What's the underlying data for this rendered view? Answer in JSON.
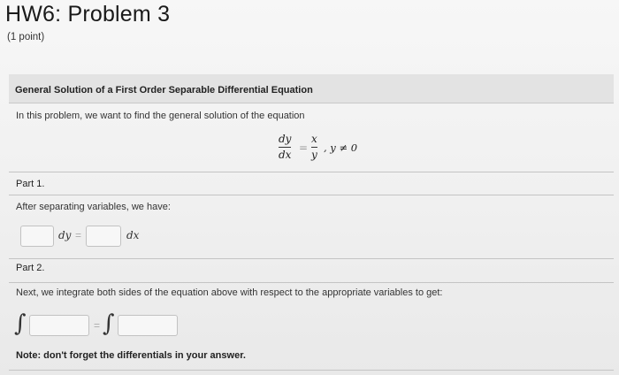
{
  "header": {
    "title": "HW6: Problem 3",
    "points": "(1 point)"
  },
  "section": {
    "title": "General Solution of a First Order Separable Differential Equation",
    "intro": "In this problem, we want to find the general solution of the equation"
  },
  "equation": {
    "lhs_num": "dy",
    "lhs_den": "dx",
    "equals": "=",
    "rhs_num": "x",
    "rhs_den": "y",
    "condition": ", y ≠ 0"
  },
  "part1": {
    "label": "Part 1.",
    "text": "After separating variables, we have:",
    "dy": "dy",
    "equals": "=",
    "dx": "dx",
    "input_left": "",
    "input_right": ""
  },
  "part2": {
    "label": "Part 2.",
    "text": "Next, we integrate both sides of the equation above with respect to the appropriate variables to get:",
    "integral_symbol": "∫",
    "equals": "=",
    "input_left": "",
    "input_right": "",
    "note": "Note: don't forget the differentials in your answer."
  }
}
